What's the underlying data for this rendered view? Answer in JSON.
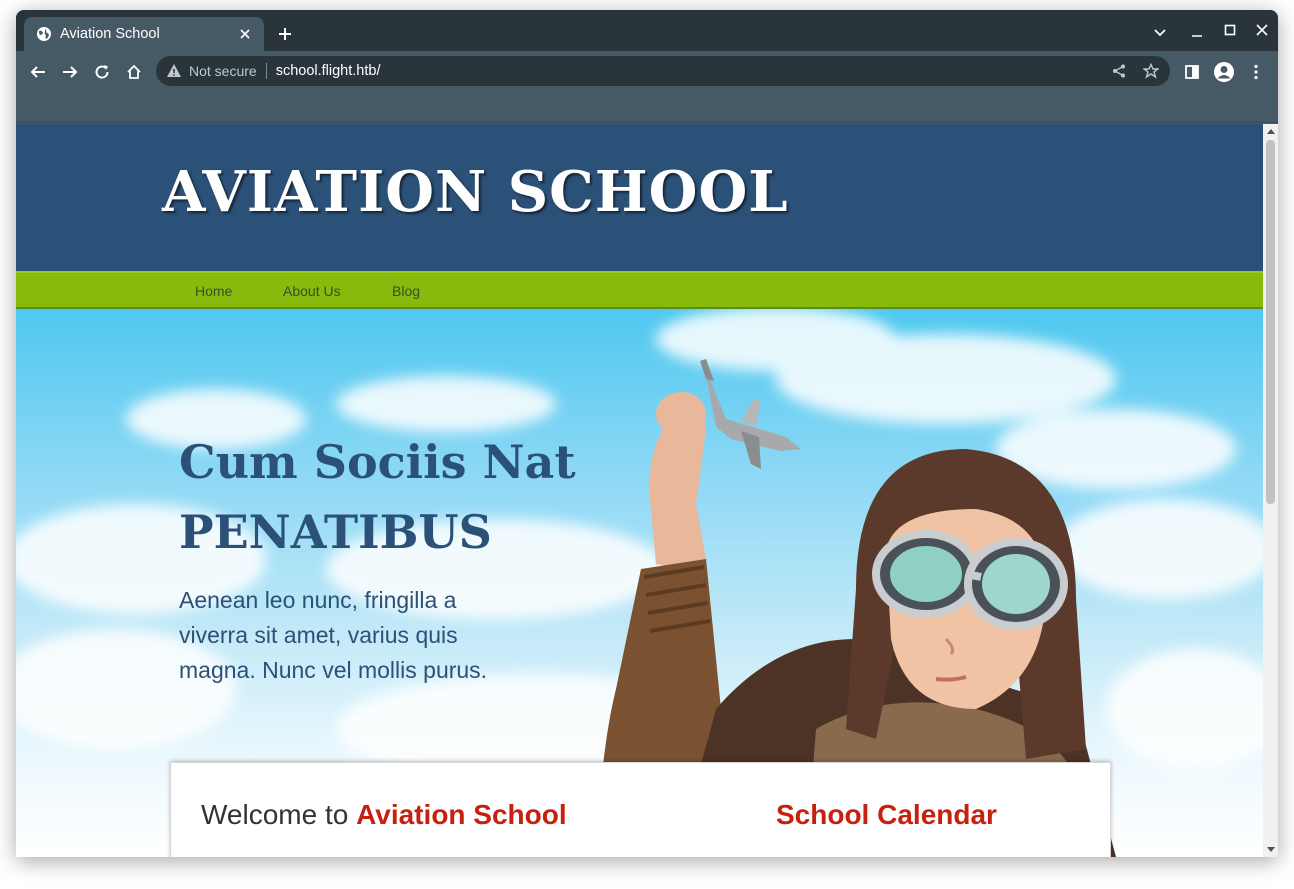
{
  "browser": {
    "tab": {
      "title": "Aviation School",
      "favicon": "globe-icon"
    },
    "address": {
      "security_label": "Not secure",
      "url": "school.flight.htb/"
    },
    "colors": {
      "tabstrip": "#29353b",
      "toolbar": "#455a64",
      "omnibox": "#29353b"
    }
  },
  "site": {
    "title": "AVIATION SCHOOL",
    "nav": [
      {
        "label": "Home"
      },
      {
        "label": "About Us"
      },
      {
        "label": "Blog"
      }
    ],
    "hero": {
      "headline_line1": "Cum Sociis Nat",
      "headline_line2": "PENATIBUS",
      "text": "Aenean leo nunc, fringilla a viverra sit amet, varius quis magna. Nunc vel mollis purus."
    },
    "content": {
      "welcome_prefix": "Welcome to",
      "welcome_accent": "Aviation School",
      "calendar_title": "School Calendar"
    },
    "colors": {
      "header": "#2b5179",
      "nav": "#86bb0d",
      "accent": "#c7200e",
      "headline": "#2b5179"
    }
  }
}
